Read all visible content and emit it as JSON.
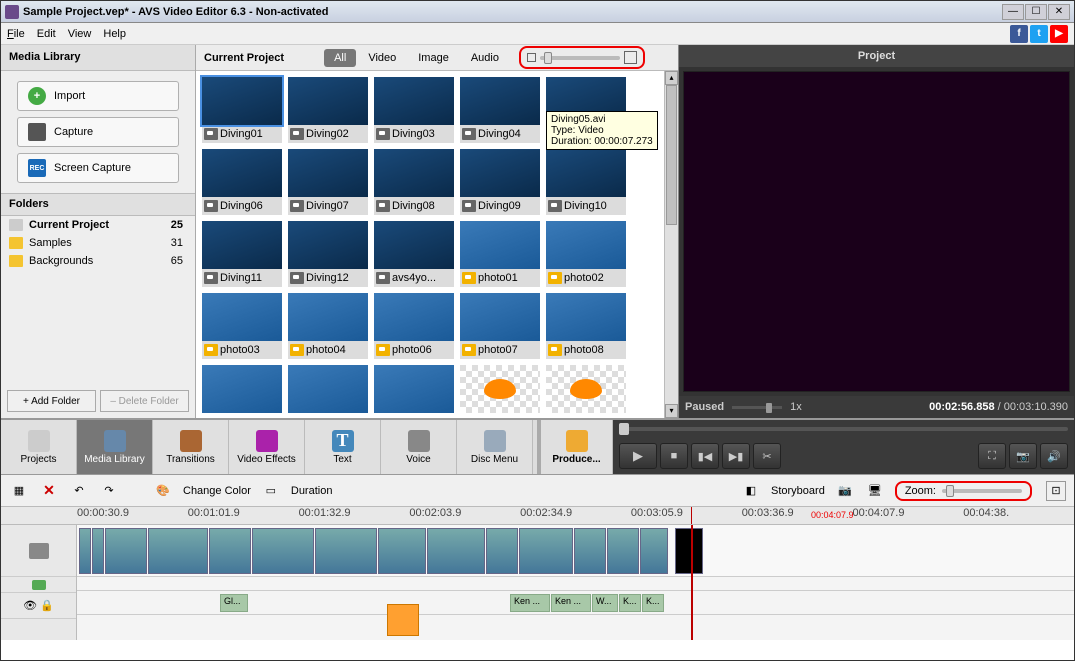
{
  "title": "Sample Project.vep* - AVS Video Editor 6.3 - Non-activated",
  "menu": {
    "file": "File",
    "edit": "Edit",
    "view": "View",
    "help": "Help"
  },
  "mediaLibrary": {
    "header": "Media Library",
    "import": "Import",
    "capture": "Capture",
    "screen": "Screen Capture"
  },
  "folders": {
    "header": "Folders",
    "items": [
      {
        "name": "Current Project",
        "count": "25",
        "sel": true
      },
      {
        "name": "Samples",
        "count": "31"
      },
      {
        "name": "Backgrounds",
        "count": "65"
      }
    ],
    "add": "+ Add Folder",
    "del": "– Delete Folder"
  },
  "project": {
    "header": "Current Project",
    "tabs": {
      "all": "All",
      "video": "Video",
      "image": "Image",
      "audio": "Audio"
    }
  },
  "clips": [
    {
      "n": "Diving01",
      "t": "v",
      "sel": true
    },
    {
      "n": "Diving02",
      "t": "v"
    },
    {
      "n": "Diving03",
      "t": "v"
    },
    {
      "n": "Diving04",
      "t": "v"
    },
    {
      "n": "",
      "t": "v"
    },
    {
      "n": "Diving06",
      "t": "v"
    },
    {
      "n": "Diving07",
      "t": "v"
    },
    {
      "n": "Diving08",
      "t": "v"
    },
    {
      "n": "Diving09",
      "t": "v"
    },
    {
      "n": "Diving10",
      "t": "v"
    },
    {
      "n": "Diving11",
      "t": "v"
    },
    {
      "n": "Diving12",
      "t": "v"
    },
    {
      "n": "avs4yo...",
      "t": "v"
    },
    {
      "n": "photo01",
      "t": "p"
    },
    {
      "n": "photo02",
      "t": "p"
    },
    {
      "n": "photo03",
      "t": "p"
    },
    {
      "n": "photo04",
      "t": "p"
    },
    {
      "n": "photo06",
      "t": "p"
    },
    {
      "n": "photo07",
      "t": "p"
    },
    {
      "n": "photo08",
      "t": "p"
    }
  ],
  "tooltip": "Diving05.avi\nType: Video\nDuration: 00:00:07.273",
  "preview": {
    "header": "Project",
    "status": "Paused",
    "speed": "1x",
    "pos": "00:02:56.858",
    "dur": "00:03:10.390"
  },
  "toolbar": {
    "projects": "Projects",
    "media": "Media Library",
    "trans": "Transitions",
    "vfx": "Video Effects",
    "text": "Text",
    "voice": "Voice",
    "disc": "Disc Menu",
    "produce": "Produce..."
  },
  "tltools": {
    "color": "Change Color",
    "duration": "Duration",
    "story": "Storyboard",
    "zoom": "Zoom:"
  },
  "ruler": [
    "00:00:30.9",
    "00:01:01.9",
    "00:01:32.9",
    "00:02:03.9",
    "00:02:34.9",
    "00:03:05.9",
    "00:03:36.9",
    "00:04:07.9",
    "00:04:38."
  ],
  "rulerSel": "00:04:07.9",
  "audioClips": [
    "Gl...",
    "Ken ...",
    "Ken ...",
    "W...",
    "K...",
    "K..."
  ]
}
